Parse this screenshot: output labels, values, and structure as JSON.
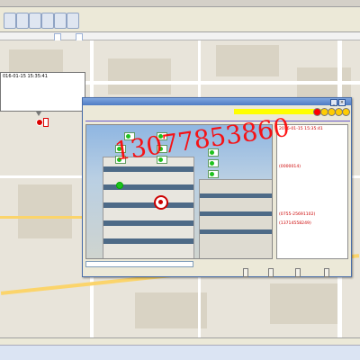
{
  "app": {
    "title": "",
    "toolbar_alert_count": ""
  },
  "map_tabs": [
    "",
    ""
  ],
  "map": {
    "popup": {
      "lines": [
        "016-01-15 15:35:41",
        "",
        "",
        "",
        "",
        ""
      ]
    },
    "marker_label": "",
    "poi_labels": [
      "",
      "",
      "",
      "",
      ""
    ]
  },
  "watermark": {
    "left_text": "",
    "phone_text": "13077853860"
  },
  "alarm": {
    "window_title": "",
    "heading": "",
    "type_label": "",
    "type_value": "",
    "banner_text": "",
    "indicator_colors": [
      "#ff0000",
      "#ffcc00",
      "#ffcc00",
      "#ffcc00",
      "#ffcc00"
    ],
    "photo_pills": [
      "",
      "",
      "",
      "",
      "",
      "",
      "",
      "",
      ""
    ],
    "details": [
      {
        "label": "",
        "value": "2016-01-15 15:35:41"
      },
      {
        "label": "",
        "value": ""
      },
      {
        "label": "",
        "value": ""
      },
      {
        "label": "",
        "value": ""
      },
      {
        "label": "",
        "value": "(0000014)"
      },
      {
        "label": "",
        "value": ""
      },
      {
        "label": "",
        "value": ""
      },
      {
        "label": "",
        "value": ""
      },
      {
        "label": "",
        "value": ""
      },
      {
        "label": "",
        "value": "(0755-25691102)"
      },
      {
        "label": "",
        "value": "(13714558249)"
      },
      {
        "label": "",
        "value": ""
      },
      {
        "label": "",
        "value": ""
      },
      {
        "label": "",
        "value": ""
      }
    ],
    "footer_text": "",
    "buttons": [
      "",
      "",
      "",
      ""
    ]
  },
  "status": {
    "left": "",
    "coord": ""
  }
}
